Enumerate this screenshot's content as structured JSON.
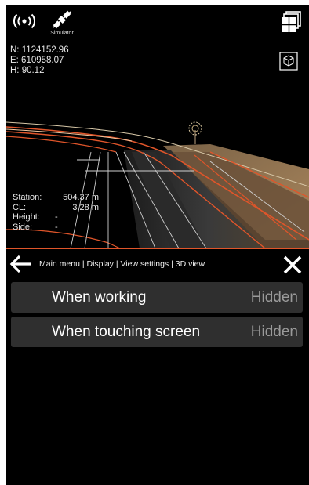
{
  "status": {
    "simulator_label": "Simulator",
    "radio_icon": "radio-signal-icon",
    "satellite_icon": "satellite-icon"
  },
  "coordinates": {
    "north": "N: 1124152.96",
    "east": "E: 610958.07",
    "height": "H: 90.12"
  },
  "station_info": {
    "station_label": "Station:",
    "station_value": "504.37 m",
    "cl_label": "CL:",
    "cl_value": "3.28 m",
    "height_label": "Height:",
    "height_value": "-",
    "side_label": "Side:",
    "side_value": "-"
  },
  "nav": {
    "breadcrumb": "Main menu | Display | View settings | 3D view"
  },
  "settings": [
    {
      "label": "When working",
      "value": "Hidden"
    },
    {
      "label": "When touching screen",
      "value": "Hidden"
    }
  ],
  "colors": {
    "accent": "#e0552a",
    "row_bg": "#2f2f2f",
    "value_text": "#9a9a9a"
  }
}
